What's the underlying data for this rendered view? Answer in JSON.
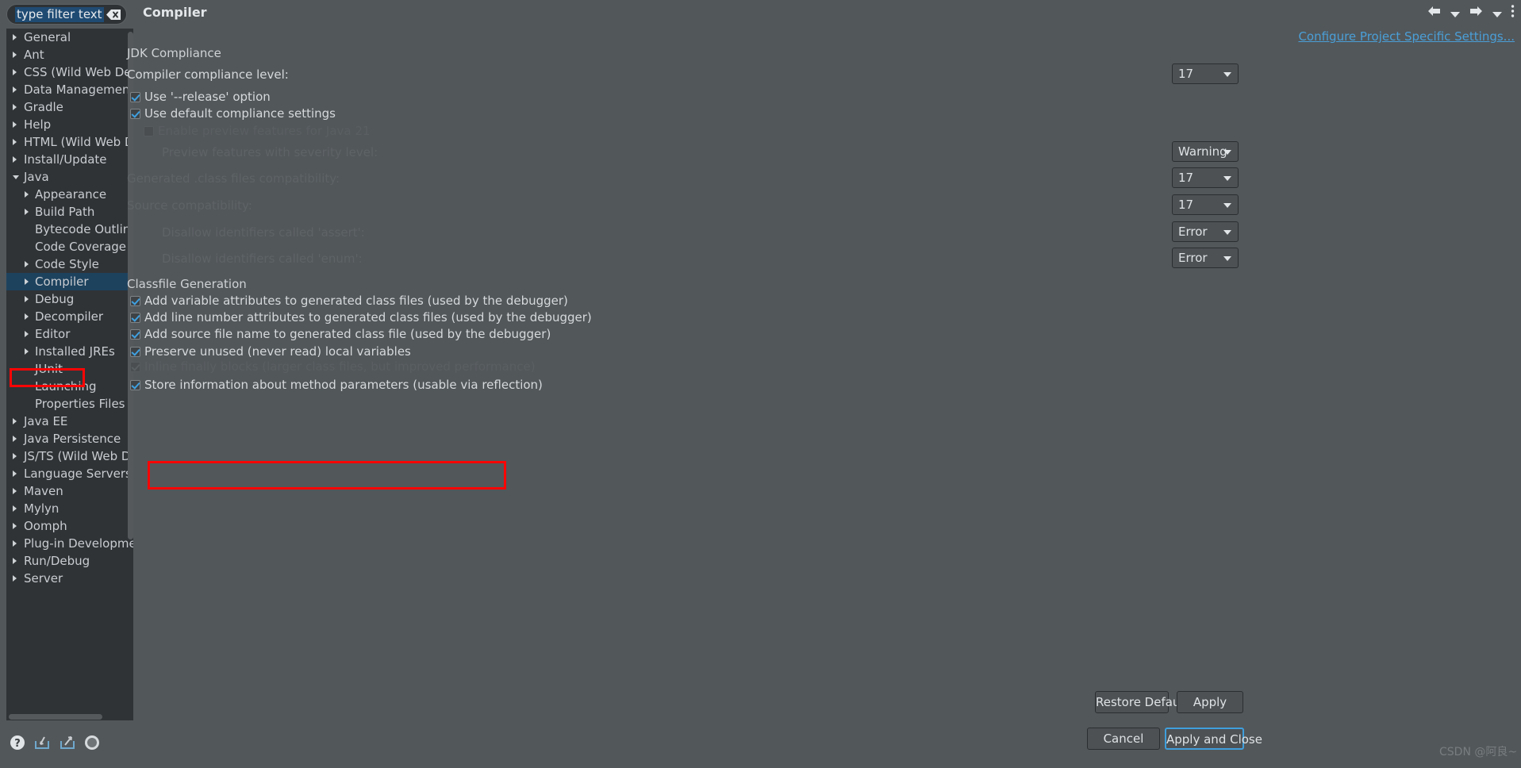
{
  "window": {
    "title": "Compiler"
  },
  "sidebar": {
    "filter": {
      "value": "type filter text",
      "placeholder": "type filter text",
      "clear_icon": "clear-icon"
    },
    "items": [
      {
        "label": "General",
        "level": 0,
        "arrow": "collapsed",
        "selected": false
      },
      {
        "label": "Ant",
        "level": 0,
        "arrow": "collapsed",
        "selected": false
      },
      {
        "label": "CSS (Wild Web Developer)",
        "level": 0,
        "arrow": "collapsed",
        "selected": false
      },
      {
        "label": "Data Management",
        "level": 0,
        "arrow": "collapsed",
        "selected": false
      },
      {
        "label": "Gradle",
        "level": 0,
        "arrow": "collapsed",
        "selected": false
      },
      {
        "label": "Help",
        "level": 0,
        "arrow": "collapsed",
        "selected": false
      },
      {
        "label": "HTML (Wild Web Developer)",
        "level": 0,
        "arrow": "collapsed",
        "selected": false
      },
      {
        "label": "Install/Update",
        "level": 0,
        "arrow": "collapsed",
        "selected": false
      },
      {
        "label": "Java",
        "level": 0,
        "arrow": "expanded",
        "selected": false
      },
      {
        "label": "Appearance",
        "level": 1,
        "arrow": "collapsed",
        "selected": false
      },
      {
        "label": "Build Path",
        "level": 1,
        "arrow": "collapsed",
        "selected": false
      },
      {
        "label": "Bytecode Outline",
        "level": 1,
        "arrow": "none",
        "selected": false
      },
      {
        "label": "Code Coverage",
        "level": 1,
        "arrow": "none",
        "selected": false
      },
      {
        "label": "Code Style",
        "level": 1,
        "arrow": "collapsed",
        "selected": false
      },
      {
        "label": "Compiler",
        "level": 1,
        "arrow": "collapsed",
        "selected": true
      },
      {
        "label": "Debug",
        "level": 1,
        "arrow": "collapsed",
        "selected": false
      },
      {
        "label": "Decompiler",
        "level": 1,
        "arrow": "collapsed",
        "selected": false
      },
      {
        "label": "Editor",
        "level": 1,
        "arrow": "collapsed",
        "selected": false
      },
      {
        "label": "Installed JREs",
        "level": 1,
        "arrow": "collapsed",
        "selected": false
      },
      {
        "label": "JUnit",
        "level": 1,
        "arrow": "none",
        "selected": false
      },
      {
        "label": "Launching",
        "level": 1,
        "arrow": "none",
        "selected": false
      },
      {
        "label": "Properties Files Editor",
        "level": 1,
        "arrow": "none",
        "selected": false
      },
      {
        "label": "Java EE",
        "level": 0,
        "arrow": "collapsed",
        "selected": false
      },
      {
        "label": "Java Persistence",
        "level": 0,
        "arrow": "collapsed",
        "selected": false
      },
      {
        "label": "JS/TS (Wild Web Developer)",
        "level": 0,
        "arrow": "collapsed",
        "selected": false
      },
      {
        "label": "Language Servers",
        "level": 0,
        "arrow": "collapsed",
        "selected": false
      },
      {
        "label": "Maven",
        "level": 0,
        "arrow": "collapsed",
        "selected": false
      },
      {
        "label": "Mylyn",
        "level": 0,
        "arrow": "collapsed",
        "selected": false
      },
      {
        "label": "Oomph",
        "level": 0,
        "arrow": "collapsed",
        "selected": false
      },
      {
        "label": "Plug-in Development",
        "level": 0,
        "arrow": "collapsed",
        "selected": false
      },
      {
        "label": "Run/Debug",
        "level": 0,
        "arrow": "collapsed",
        "selected": false
      },
      {
        "label": "Server",
        "level": 0,
        "arrow": "collapsed",
        "selected": false
      }
    ],
    "bottom_icons": [
      {
        "name": "help-icon"
      },
      {
        "name": "import-icon"
      },
      {
        "name": "export-icon"
      },
      {
        "name": "globe-icon"
      }
    ]
  },
  "toolbar": {
    "back_icon": "back-arrow-icon",
    "back_menu_icon": "chevron-down-icon",
    "forward_icon": "forward-arrow-icon",
    "forward_menu_icon": "chevron-down-icon",
    "overflow_icon": "vertical-dots-icon"
  },
  "main": {
    "project_settings_link": "Configure Project Specific Settings...",
    "jdk_section": {
      "title": "JDK Compliance",
      "compliance_label": "Compiler compliance level:",
      "compliance_value": "17",
      "use_release_option": {
        "label": "Use '--release' option",
        "checked": true,
        "enabled": true
      },
      "use_default_compliance": {
        "label": "Use default compliance settings",
        "checked": true,
        "enabled": true
      },
      "enable_preview": {
        "label": "Enable preview features for Java 21",
        "checked": false,
        "enabled": false
      },
      "preview_severity_label": "Preview features with severity level:",
      "preview_severity_value": "Warning",
      "classfile_compat_label": "Generated .class files compatibility:",
      "classfile_compat_value": "17",
      "source_compat_label": "Source compatibility:",
      "source_compat_value": "17",
      "disallow_assert_label": "Disallow identifiers called 'assert':",
      "disallow_assert_value": "Error",
      "disallow_enum_label": "Disallow identifiers called 'enum':",
      "disallow_enum_value": "Error"
    },
    "classfile_section": {
      "title": "Classfile Generation",
      "options": [
        {
          "label": "Add variable attributes to generated class files (used by the debugger)",
          "checked": true,
          "enabled": true
        },
        {
          "label": "Add line number attributes to generated class files (used by the debugger)",
          "checked": true,
          "enabled": true
        },
        {
          "label": "Add source file name to generated class file (used by the debugger)",
          "checked": true,
          "enabled": true
        },
        {
          "label": "Preserve unused (never read) local variables",
          "checked": true,
          "enabled": true
        },
        {
          "label": "Inline finally blocks (larger class files, but improved performance)",
          "checked": true,
          "enabled": false
        },
        {
          "label": "Store information about method parameters (usable via reflection)",
          "checked": true,
          "enabled": true
        }
      ]
    }
  },
  "buttons": {
    "restore_defaults": "Restore Defaults",
    "apply": "Apply",
    "cancel": "Cancel",
    "apply_and_close": "Apply and Close"
  },
  "watermark": "CSDN @阿良~",
  "colors": {
    "background": "#52575a",
    "tree_background": "#2f3336",
    "selection": "#1d425e",
    "link": "#4a9fd8",
    "checkmark": "#3fa0e0",
    "annotation": "#fb0505",
    "disabled_text": "#5a5f62"
  }
}
